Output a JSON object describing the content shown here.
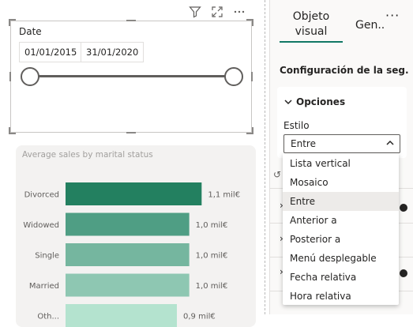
{
  "slicer": {
    "title": "Date",
    "start_date": "01/01/2015",
    "end_date": "31/01/2020"
  },
  "chart_data": {
    "type": "bar",
    "orientation": "horizontal",
    "title": "Average sales by marital status",
    "categories": [
      "Divorced",
      "Widowed",
      "Single",
      "Married",
      "Oth..."
    ],
    "values": [
      1.1,
      1.0,
      1.0,
      1.0,
      0.9
    ],
    "data_labels": [
      "1,1 mil€",
      "1,0 mil€",
      "1,0 mil€",
      "1,0 mil€",
      "0,9 mil€"
    ],
    "colors": [
      "#238060",
      "#4f9e84",
      "#75b69f",
      "#8ec7b2",
      "#b4e3cf"
    ],
    "xlim": [
      0,
      1.2
    ],
    "grid": false
  },
  "pane": {
    "tab_visual_line1": "Objeto",
    "tab_visual_line2": "visual",
    "tab_general": "Gen..",
    "more": "···",
    "section_title": "Configuración de la seg...",
    "options_title": "Opciones",
    "style_label": "Estilo",
    "style_value": "Entre"
  },
  "dropdown": {
    "options": [
      "Lista vertical",
      "Mosaico",
      "Entre",
      "Anterior a",
      "Posterior a",
      "Menú desplegable",
      "Fecha relativa",
      "Hora relativa"
    ],
    "selected": "Entre"
  },
  "theme": {
    "accent": "#117865"
  }
}
